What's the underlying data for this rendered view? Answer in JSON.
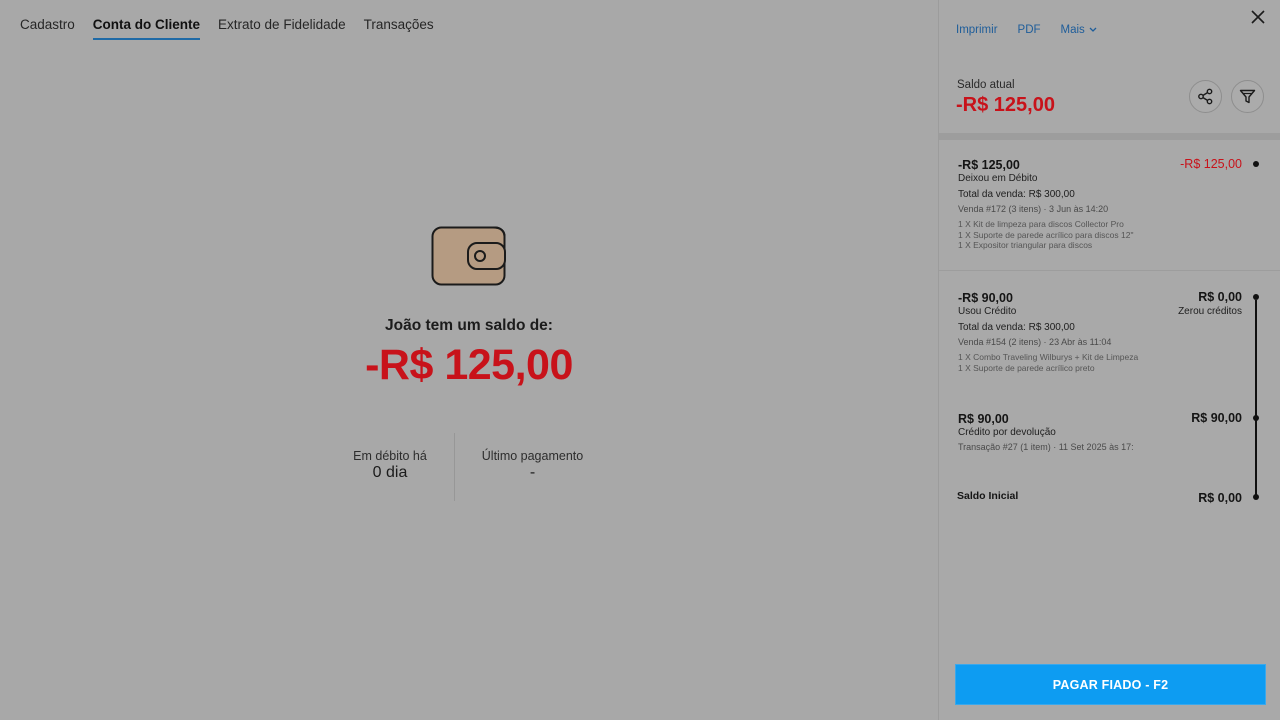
{
  "tabs": [
    {
      "label": "Cadastro",
      "active": false
    },
    {
      "label": "Conta do Cliente",
      "active": true
    },
    {
      "label": "Extrato de Fidelidade",
      "active": false
    },
    {
      "label": "Transações",
      "active": false
    }
  ],
  "main": {
    "caption": "João tem um saldo de:",
    "amount": "-R$ 125,00",
    "stats": {
      "debt_label": "Em débito há",
      "debt_value": "0 dia",
      "last_payment_label": "Último pagamento",
      "last_payment_value": "-"
    }
  },
  "panel": {
    "actions": {
      "print": "Imprimir",
      "pdf": "PDF",
      "more": "Mais"
    },
    "saldo_label": "Saldo atual",
    "saldo_value": "-R$ 125,00",
    "entries": [
      {
        "amount": "-R$ 125,00",
        "type": "Deixou em Débito",
        "total": "Total da venda: R$ 300,00",
        "meta": "Venda #172 (3 itens)  ·  3 Jun às 14:20",
        "items": [
          "1 X Kit de limpeza para discos Collector Pro",
          "1 X Suporte de parede acrílico para discos 12\"",
          "1 X Expositor triangular para discos"
        ],
        "balance": "-R$ 125,00",
        "balance_note": ""
      },
      {
        "amount": "-R$ 90,00",
        "type": "Usou Crédito",
        "total": "Total da venda: R$ 300,00",
        "meta": "Venda #154 (2 itens)  ·  23 Abr às 11:04",
        "items": [
          "1 X Combo Traveling Wilburys + Kit de Limpeza",
          "1 X Suporte de parede acrílico preto"
        ],
        "balance": "R$ 0,00",
        "balance_note": "Zerou créditos"
      },
      {
        "amount": "R$ 90,00",
        "type": "Crédito por devolução",
        "meta": "Transação #27 (1 item)  ·  11 Set 2025 às 17:",
        "balance": "R$ 90,00"
      }
    ],
    "initial_label": "Saldo Inicial",
    "initial_value": "R$ 0,00",
    "pay_button": "PAGAR FIADO - F2"
  },
  "colors": {
    "negative": "#c8121a",
    "link": "#1e5d9a",
    "primary": "#0d9cf2",
    "tab_underline": "#1f6aa6"
  },
  "icons": [
    "wallet-icon",
    "close-icon",
    "chevron-down-icon",
    "share-icon",
    "filter-icon"
  ]
}
